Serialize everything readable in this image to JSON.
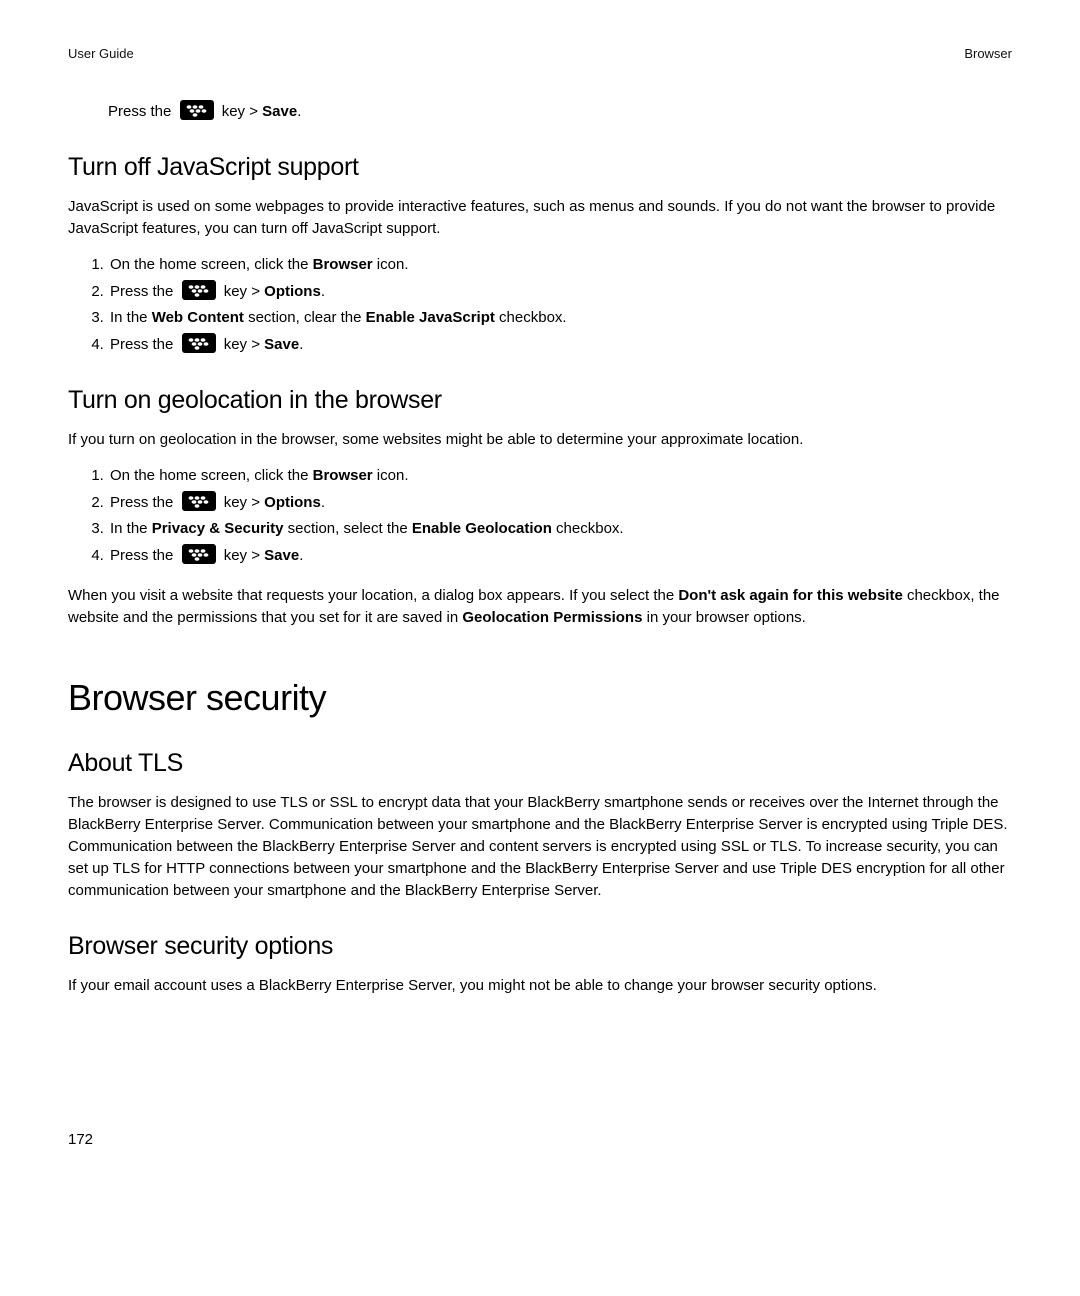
{
  "header": {
    "left": "User Guide",
    "right": "Browser"
  },
  "intro_line": {
    "press_the": "Press the",
    "key_gt": " key > ",
    "save": "Save",
    "period": "."
  },
  "js_section": {
    "title": "Turn off JavaScript support",
    "body": "JavaScript is used on some webpages to provide interactive features, such as menus and sounds. If you do not want the browser to provide JavaScript features, you can turn off JavaScript support.",
    "step1_a": "On the home screen, click the ",
    "step1_b": "Browser",
    "step1_c": " icon.",
    "step2_a": "Press the",
    "step2_b": " key > ",
    "step2_c": "Options",
    "step2_d": ".",
    "step3_a": "In the ",
    "step3_b": "Web Content",
    "step3_c": " section, clear the ",
    "step3_d": "Enable JavaScript",
    "step3_e": " checkbox.",
    "step4_a": "Press the",
    "step4_b": " key > ",
    "step4_c": "Save",
    "step4_d": "."
  },
  "geo_section": {
    "title": "Turn on geolocation in the browser",
    "body": "If you turn on geolocation in the browser, some websites might be able to determine your approximate location.",
    "step1_a": "On the home screen, click the ",
    "step1_b": "Browser",
    "step1_c": " icon.",
    "step2_a": "Press the",
    "step2_b": " key > ",
    "step2_c": "Options",
    "step2_d": ".",
    "step3_a": "In the ",
    "step3_b": "Privacy & Security",
    "step3_c": " section, select the ",
    "step3_d": "Enable Geolocation",
    "step3_e": " checkbox.",
    "step4_a": "Press the",
    "step4_b": " key > ",
    "step4_c": "Save",
    "step4_d": ".",
    "after_a": "When you visit a website that requests your location, a dialog box appears. If you select the ",
    "after_b": "Don't ask again for this website",
    "after_c": " checkbox, the website and the permissions that you set for it are saved in ",
    "after_d": "Geolocation Permissions",
    "after_e": " in your browser options."
  },
  "security_section": {
    "big_title": "Browser security",
    "tls_title": "About TLS",
    "tls_body": "The browser is designed to use TLS or SSL to encrypt data that your BlackBerry smartphone sends or receives over the Internet through the BlackBerry Enterprise Server. Communication between your smartphone and the BlackBerry Enterprise Server is encrypted using Triple DES. Communication between the BlackBerry Enterprise Server and content servers is encrypted using SSL or TLS. To increase security, you can set up TLS for HTTP connections between your smartphone and the BlackBerry Enterprise Server and use Triple DES encryption for all other communication between your smartphone and the BlackBerry Enterprise Server.",
    "options_title": "Browser security options",
    "options_body": "If your email account uses a BlackBerry Enterprise Server, you might not be able to change your browser security options."
  },
  "page_number": "172"
}
